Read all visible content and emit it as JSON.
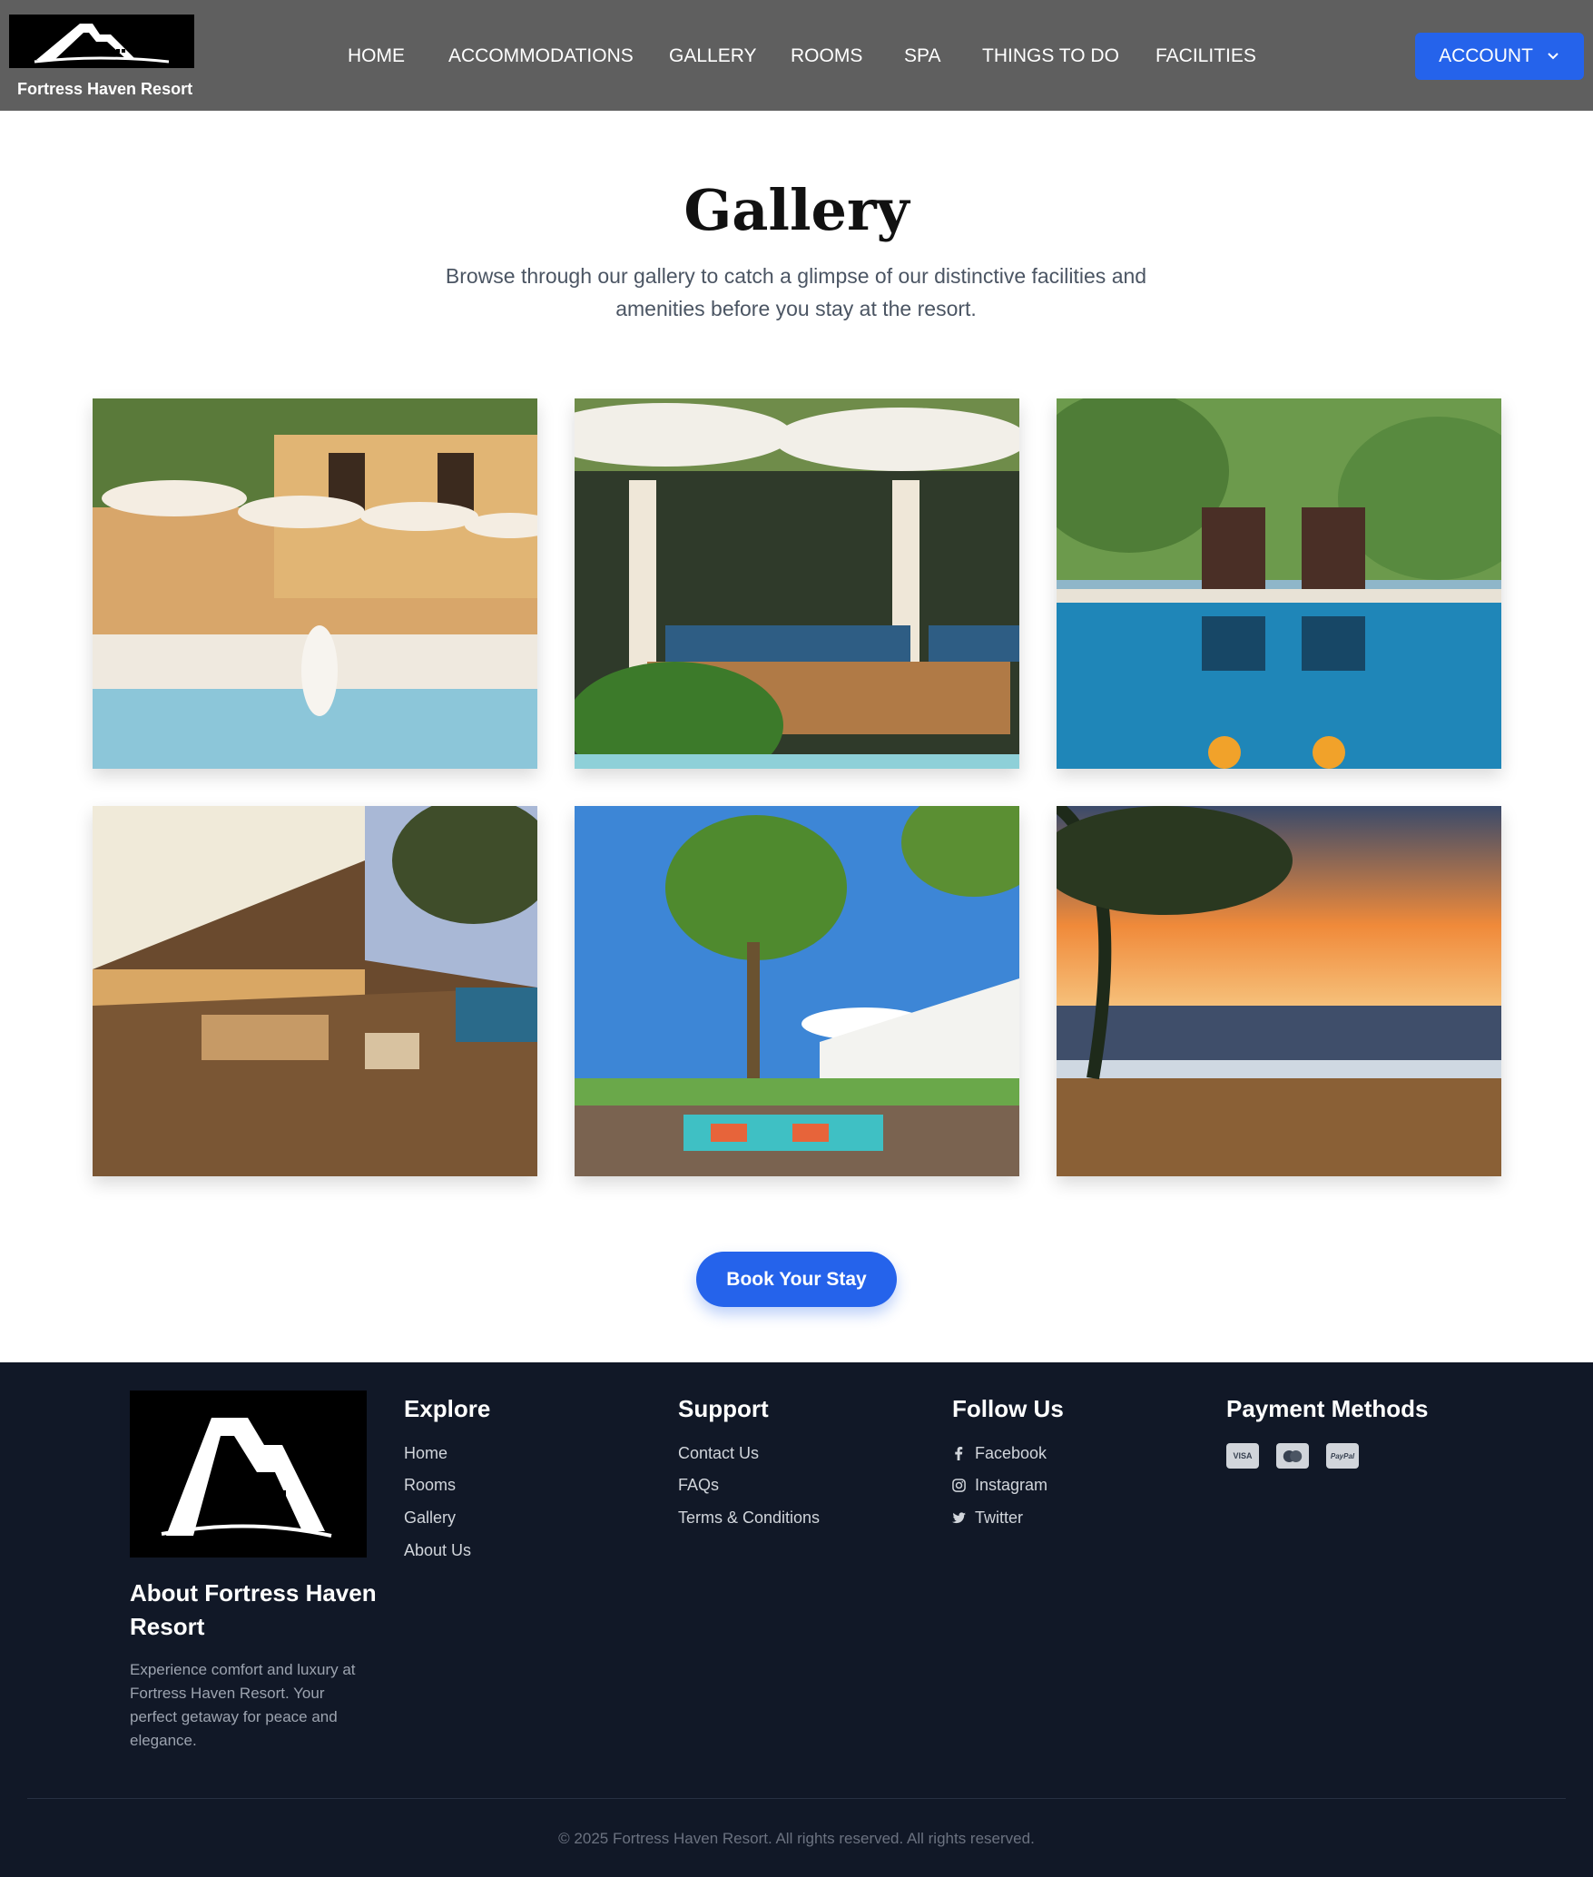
{
  "header": {
    "brand_name": "Fortress Haven Resort",
    "nav": [
      "HOME",
      "ACCOMMODATIONS",
      "GALLERY",
      "ROOMS",
      "SPA",
      "THINGS TO DO",
      "FACILITIES"
    ],
    "account_label": "ACCOUNT",
    "account_icon": "chevron-down-icon"
  },
  "main": {
    "title": "Gallery",
    "subtitle_line1": "Browse through our gallery to catch a glimpse of our distinctive facilities and",
    "subtitle_line2": "amenities before you stay at the resort.",
    "photos": [
      {
        "subject": "pool-with-umbrellas"
      },
      {
        "subject": "cabana-loungers"
      },
      {
        "subject": "poolside-chairs-drinks"
      },
      {
        "subject": "terrace-dining"
      },
      {
        "subject": "resort-pool-garden"
      },
      {
        "subject": "beach-sunset"
      }
    ],
    "book_label": "Book Your Stay"
  },
  "footer": {
    "about_title": "About Fortress Haven Resort",
    "about_text": "Experience comfort and luxury at Fortress Haven Resort. Your perfect getaway for peace and elegance.",
    "explore": {
      "title": "Explore",
      "links": [
        "Home",
        "Rooms",
        "Gallery",
        "About Us"
      ]
    },
    "support": {
      "title": "Support",
      "links": [
        "Contact Us",
        "FAQs",
        "Terms & Conditions"
      ]
    },
    "follow": {
      "title": "Follow Us",
      "links": [
        "Facebook",
        "Instagram",
        "Twitter"
      ]
    },
    "payment": {
      "title": "Payment Methods",
      "methods": [
        "VISA",
        "mastercard",
        "PayPal"
      ]
    },
    "copyright": "© 2025 Fortress Haven Resort. All rights reserved. All rights reserved."
  },
  "colors": {
    "header_bg": "#5f5f5f",
    "accent": "#2563eb",
    "footer_bg": "#111827"
  }
}
